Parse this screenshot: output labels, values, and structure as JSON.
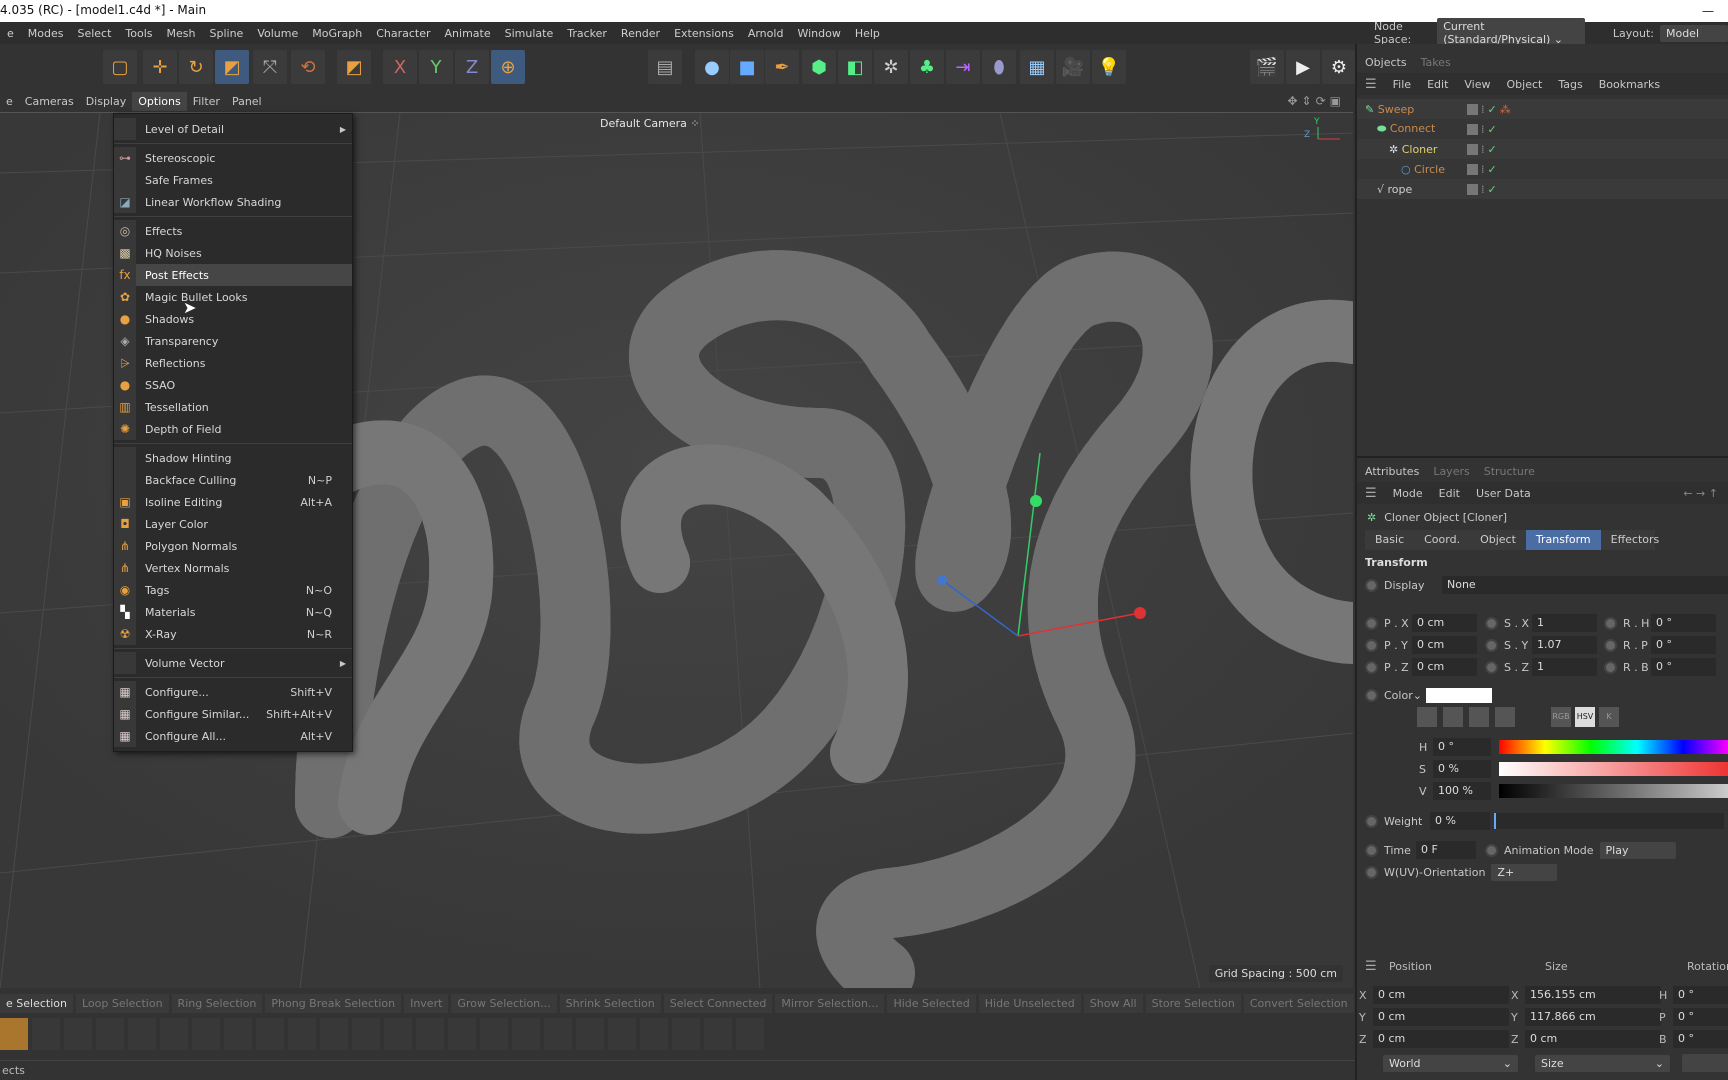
{
  "window": {
    "title": "4.035 (RC) - [model1.c4d *] - Main",
    "minimize": "—"
  },
  "menubar": [
    "e",
    "Modes",
    "Select",
    "Tools",
    "Mesh",
    "Spline",
    "Volume",
    "MoGraph",
    "Character",
    "Animate",
    "Simulate",
    "Tracker",
    "Render",
    "Extensions",
    "Arnold",
    "Window",
    "Help"
  ],
  "nodespace": {
    "label": "Node Space:",
    "value": "Current (Standard/Physical)",
    "layout_label": "Layout:",
    "layout_value": "Model"
  },
  "viewport_menu": [
    "e",
    "Cameras",
    "Display",
    "Options",
    "Filter",
    "Panel"
  ],
  "viewport": {
    "camera": "Default Camera",
    "grid_spacing": "Grid Spacing : 500 cm",
    "axis_y": "Y",
    "axis_z": "Z"
  },
  "options_menu": [
    {
      "label": "Level of Detail",
      "icon": "none",
      "submenu": true
    },
    {
      "sep": true
    },
    {
      "label": "Stereoscopic",
      "icon": "stereo-glasses"
    },
    {
      "label": "Safe Frames",
      "icon": "none"
    },
    {
      "label": "Linear Workflow Shading",
      "icon": "linear-workflow"
    },
    {
      "sep": true
    },
    {
      "label": "Effects",
      "icon": "effects"
    },
    {
      "label": "HQ Noises",
      "icon": "noise"
    },
    {
      "label": "Post Effects",
      "icon": "fx",
      "highlight": true
    },
    {
      "label": "Magic Bullet Looks",
      "icon": "magic-bullet"
    },
    {
      "label": "Shadows",
      "icon": "shadow"
    },
    {
      "label": "Transparency",
      "icon": "transparency"
    },
    {
      "label": "Reflections",
      "icon": "reflection"
    },
    {
      "label": "SSAO",
      "icon": "ssao"
    },
    {
      "label": "Tessellation",
      "icon": "tessellation"
    },
    {
      "label": "Depth of Field",
      "icon": "depth-of-field"
    },
    {
      "sep": true
    },
    {
      "label": "Shadow Hinting",
      "icon": "none"
    },
    {
      "label": "Backface Culling",
      "icon": "none",
      "shortcut": "N~P"
    },
    {
      "label": "Isoline Editing",
      "icon": "isoline",
      "shortcut": "Alt+A"
    },
    {
      "label": "Layer Color",
      "icon": "layer"
    },
    {
      "label": "Polygon Normals",
      "icon": "polygon-normals"
    },
    {
      "label": "Vertex Normals",
      "icon": "vertex-normals"
    },
    {
      "label": "Tags",
      "icon": "eye",
      "shortcut": "N~O"
    },
    {
      "label": "Materials",
      "icon": "checker",
      "shortcut": "N~Q"
    },
    {
      "label": "X-Ray",
      "icon": "x-ray",
      "shortcut": "N~R"
    },
    {
      "sep": true
    },
    {
      "label": "Volume Vector",
      "icon": "none",
      "submenu": true
    },
    {
      "sep": true
    },
    {
      "label": "Configure...",
      "icon": "configure",
      "shortcut": "Shift+V"
    },
    {
      "label": "Configure Similar...",
      "icon": "configure",
      "shortcut": "Shift+Alt+V"
    },
    {
      "label": "Configure All...",
      "icon": "configure",
      "shortcut": "Alt+V"
    }
  ],
  "objects": {
    "tabs": [
      "Objects",
      "Takes"
    ],
    "menu": [
      "File",
      "Edit",
      "View",
      "Object",
      "Tags",
      "Bookmarks"
    ],
    "tree": [
      {
        "name": "Sweep",
        "depth": 0,
        "color": "#c98a4a"
      },
      {
        "name": "Connect",
        "depth": 1,
        "color": "#c98a4a"
      },
      {
        "name": "Cloner",
        "depth": 2,
        "color": "#e0d070"
      },
      {
        "name": "Circle",
        "depth": 3,
        "color": "#c98a4a"
      },
      {
        "name": "rope",
        "depth": 1,
        "color": "#d0d0d0"
      }
    ]
  },
  "attributes": {
    "tabs": [
      "Attributes",
      "Layers",
      "Structure"
    ],
    "menu": [
      "Mode",
      "Edit",
      "User Data"
    ],
    "title": "Cloner Object [Cloner]",
    "subtabs": [
      "Basic",
      "Coord.",
      "Object",
      "Transform",
      "Effectors"
    ],
    "active_subtab": "Transform",
    "section": "Transform",
    "display_label": "Display",
    "display_value": "None",
    "p": [
      {
        "l": "P . X",
        "v": "0 cm"
      },
      {
        "l": "P . Y",
        "v": "0 cm"
      },
      {
        "l": "P . Z",
        "v": "0 cm"
      }
    ],
    "s": [
      {
        "l": "S . X",
        "v": "1"
      },
      {
        "l": "S . Y",
        "v": "1.07"
      },
      {
        "l": "S . Z",
        "v": "1"
      }
    ],
    "r": [
      {
        "l": "R . H",
        "v": "0 °"
      },
      {
        "l": "R . P",
        "v": "0 °"
      },
      {
        "l": "R . B",
        "v": "0 °"
      }
    ],
    "color_label": "Color",
    "color_value": "#ffffff",
    "color_modes": [
      "RGB",
      "HSV",
      "K"
    ],
    "h": {
      "l": "H",
      "v": "0 °"
    },
    "s_": {
      "l": "S",
      "v": "0 %"
    },
    "v": {
      "l": "V",
      "v": "100 %"
    },
    "weight_label": "Weight",
    "weight_value": "0 %",
    "time_label": "Time",
    "time_value": "0 F",
    "anim_label": "Animation Mode",
    "anim_value": "Play",
    "uv_label": "W(UV)-Orientation",
    "uv_value": "Z+"
  },
  "coords": {
    "headers": [
      "Position",
      "Size",
      "Rotation"
    ],
    "rows": [
      [
        "X",
        "0 cm",
        "X",
        "156.155 cm",
        "H",
        "0 °"
      ],
      [
        "Y",
        "0 cm",
        "Y",
        "117.866 cm",
        "P",
        "0 °"
      ],
      [
        "Z",
        "0 cm",
        "Z",
        "0 cm",
        "B",
        "0 °"
      ]
    ],
    "pos_mode": "World",
    "size_mode": "Size"
  },
  "selection_bar": [
    "e Selection",
    "Loop Selection",
    "Ring Selection",
    "Phong Break Selection",
    "Invert",
    "Grow Selection...",
    "Shrink Selection",
    "Select Connected",
    "Mirror Selection...",
    "Hide Selected",
    "Hide Unselected",
    "Show All",
    "Store Selection",
    "Convert Selection"
  ],
  "status": "ects"
}
